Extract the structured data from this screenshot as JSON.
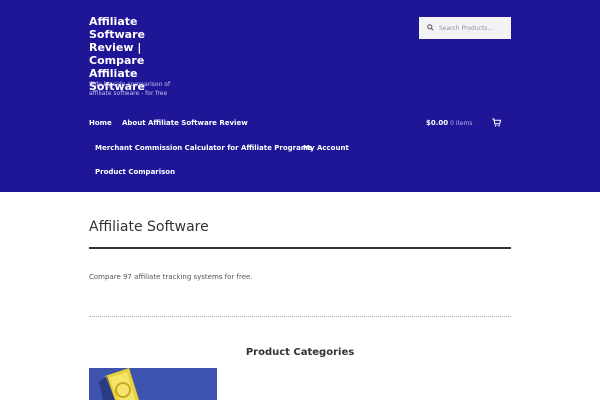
{
  "site": {
    "title": "Affiliate Software Review | Compare Affiliate Software",
    "description": "Side by side comparison of affiliate software - for free"
  },
  "search": {
    "placeholder": "Search Products…",
    "icon": "search-icon"
  },
  "nav": {
    "items": [
      {
        "label": "Home"
      },
      {
        "label": "About Affiliate Software Review"
      },
      {
        "label": "Merchant Commission Calculator for Affiliate Programs"
      },
      {
        "label": "My Account"
      },
      {
        "label": "Product Comparison"
      }
    ]
  },
  "cart": {
    "amount": "$0.00",
    "items": "0 items",
    "icon": "cart-icon"
  },
  "page": {
    "title": "Affiliate Software",
    "intro": "Compare 97 affiliate tracking systems for free.",
    "categories_heading": "Product Categories"
  },
  "colors": {
    "header_bg": "#1f1597",
    "text": "#333333"
  }
}
